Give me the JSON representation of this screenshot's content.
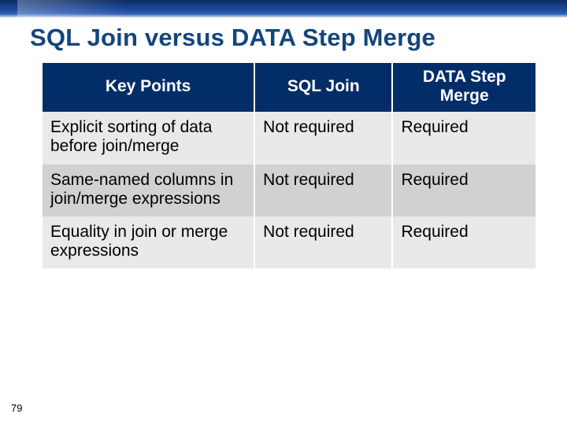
{
  "title": "SQL Join versus DATA Step Merge",
  "pageNumber": "79",
  "table": {
    "headers": {
      "c1": "Key Points",
      "c2": "SQL Join",
      "c3": "DATA Step Merge"
    },
    "rows": [
      {
        "c1": "Explicit sorting of data before join/merge",
        "c2": "Not required",
        "c3": "Required"
      },
      {
        "c1": "Same-named columns in join/merge expressions",
        "c2": "Not required",
        "c3": "Required"
      },
      {
        "c1": "Equality in join or merge expressions",
        "c2": "Not required",
        "c3": "Required"
      }
    ]
  },
  "chart_data": {
    "type": "table",
    "title": "SQL Join versus DATA Step Merge",
    "columns": [
      "Key Points",
      "SQL Join",
      "DATA Step Merge"
    ],
    "rows": [
      [
        "Explicit sorting of data before join/merge",
        "Not required",
        "Required"
      ],
      [
        "Same-named columns in join/merge expressions",
        "Not required",
        "Required"
      ],
      [
        "Equality in join or merge expressions",
        "Not required",
        "Required"
      ]
    ]
  }
}
